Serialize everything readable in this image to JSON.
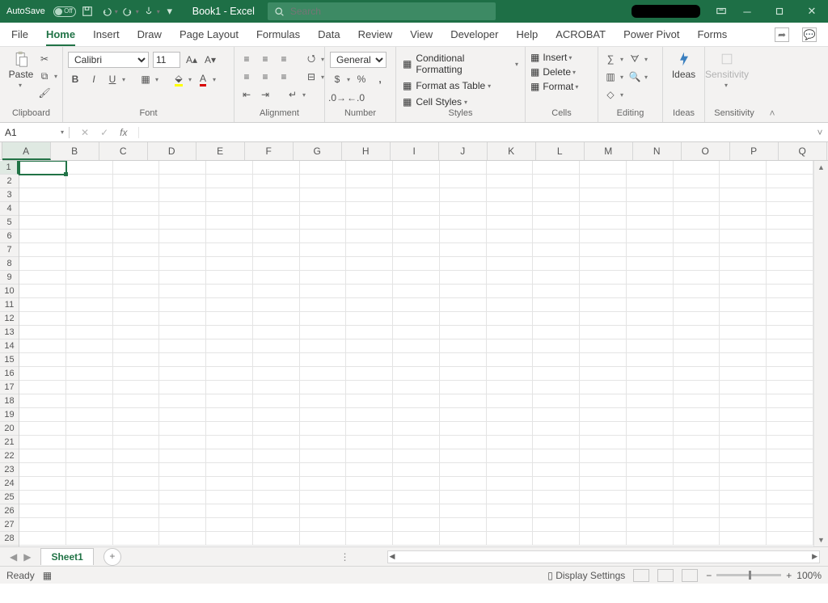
{
  "title_bar": {
    "autosave_label": "AutoSave",
    "autosave_state": "Off",
    "document_title": "Book1 - Excel",
    "search_placeholder": "Search"
  },
  "ribbon": {
    "tabs": [
      "File",
      "Home",
      "Insert",
      "Draw",
      "Page Layout",
      "Formulas",
      "Data",
      "Review",
      "View",
      "Developer",
      "Help",
      "ACROBAT",
      "Power Pivot",
      "Forms"
    ],
    "active_tab": "Home",
    "clipboard": {
      "paste": "Paste",
      "label": "Clipboard"
    },
    "font": {
      "label": "Font",
      "name": "Calibri",
      "size": "11",
      "bold": "B",
      "italic": "I",
      "underline": "U"
    },
    "alignment": {
      "label": "Alignment"
    },
    "number": {
      "label": "Number",
      "format": "General"
    },
    "styles": {
      "label": "Styles",
      "cf": "Conditional Formatting",
      "fat": "Format as Table",
      "cs": "Cell Styles"
    },
    "cells": {
      "label": "Cells",
      "ins": "Insert",
      "del": "Delete",
      "fmt": "Format"
    },
    "editing": {
      "label": "Editing"
    },
    "ideas": {
      "label": "Ideas",
      "btn": "Ideas"
    },
    "sensitivity": {
      "label": "Sensitivity",
      "btn": "Sensitivity"
    }
  },
  "formula_bar": {
    "name_box": "A1",
    "formula": ""
  },
  "grid": {
    "columns": [
      "A",
      "B",
      "C",
      "D",
      "E",
      "F",
      "G",
      "H",
      "I",
      "J",
      "K",
      "L",
      "M",
      "N",
      "O",
      "P",
      "Q"
    ],
    "row_count": 28,
    "active_cell": "A1"
  },
  "sheet_tabs": {
    "tabs": [
      "Sheet1"
    ]
  },
  "status_bar": {
    "status": "Ready",
    "display_settings": "Display Settings",
    "zoom": "100%"
  }
}
